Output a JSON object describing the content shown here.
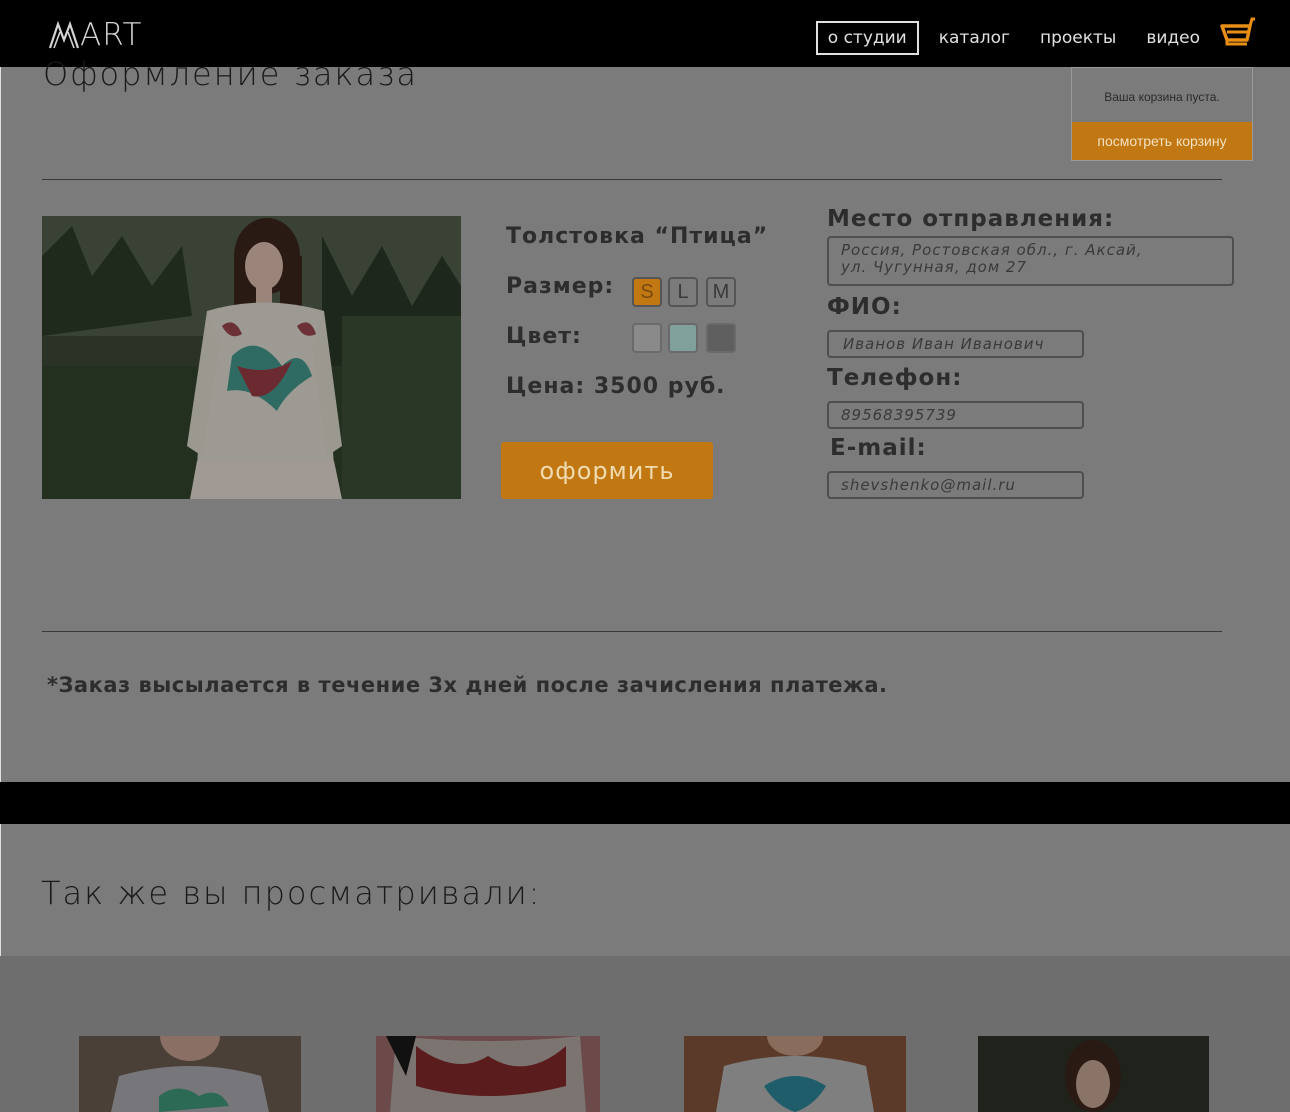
{
  "header": {
    "logo_text": "ART",
    "nav": [
      {
        "label": "о студии",
        "active": true
      },
      {
        "label": "каталог",
        "active": false
      },
      {
        "label": "проекты",
        "active": false
      },
      {
        "label": "видео",
        "active": false
      }
    ],
    "cart_icon": "shopping-cart-icon",
    "accent_color": "#e88e14"
  },
  "cart_popup": {
    "empty_text": "Ваша корзина пуста.",
    "view_button": "посмотреть корзину"
  },
  "order": {
    "title": "Оформление заказа",
    "product_name": "Толстовка “Птица”",
    "size_label": "Размер:",
    "sizes": [
      {
        "label": "S",
        "selected": true
      },
      {
        "label": "L",
        "selected": false
      },
      {
        "label": "M",
        "selected": false
      }
    ],
    "color_label": "Цвет:",
    "colors": [
      "#8a8a8a",
      "#7fa09b",
      "#5f5f5f"
    ],
    "price": "Цена: 3500 руб.",
    "submit_button": "оформить"
  },
  "form": {
    "address_label": "Место отправления:",
    "address_value": "Россия, Ростовская обл., г. Аксай,\nул. Чугунная, дом 27",
    "name_label": "ФИО:",
    "name_value": "Иванов Иван Иванович",
    "phone_label": "Телефон:",
    "phone_value": "89568395739",
    "email_label": "E-mail:",
    "email_value": "shevshenko@mail.ru"
  },
  "note": "*Заказ высылается в течение 3х дней после зачисления платежа.",
  "viewed": {
    "title": "Так же вы просматривали:"
  }
}
